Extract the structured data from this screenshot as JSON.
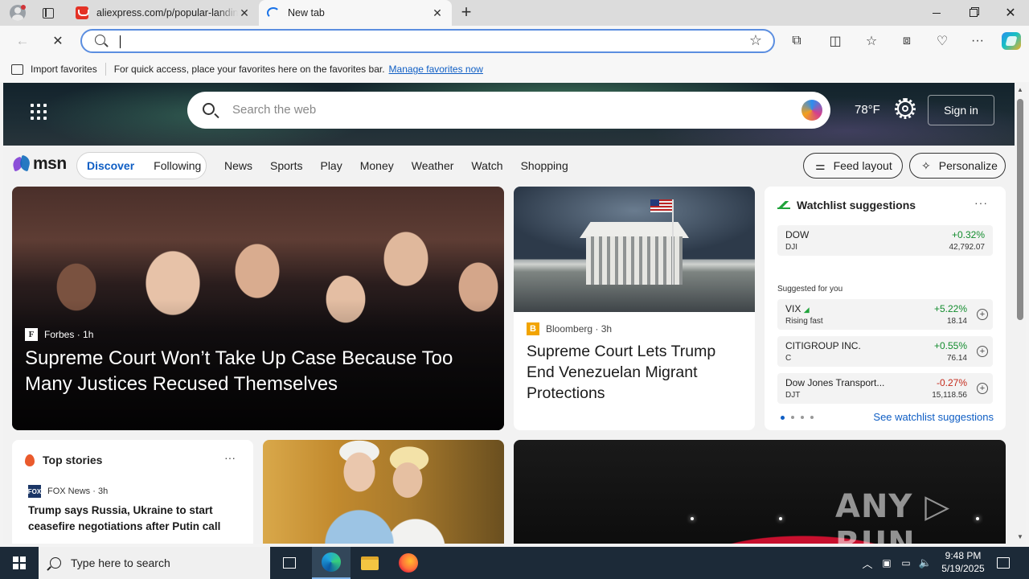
{
  "browser": {
    "tabs": [
      {
        "title": "aliexpress.com/p/popular-landing",
        "close": "✕"
      },
      {
        "title": "New tab",
        "close": "✕"
      }
    ],
    "new_tab": "+",
    "address": {
      "value": ""
    },
    "window": {
      "close": "✕"
    },
    "favorites_bar": {
      "import_label": "Import favorites",
      "message": "For quick access, place your favorites here on the favorites bar.",
      "manage_link": "Manage favorites now"
    }
  },
  "msn": {
    "search_placeholder": "Search the web",
    "weather": "78°F",
    "sign_in": "Sign in",
    "logo": "msn",
    "feed_tabs": {
      "active": "Discover",
      "inactive": "Following"
    },
    "nav": [
      "News",
      "Sports",
      "Play",
      "Money",
      "Weather",
      "Watch",
      "Shopping"
    ],
    "feed_layout": "Feed layout",
    "personalize": "Personalize",
    "hero_card": {
      "source": "Forbes",
      "age": "1h",
      "headline": "Supreme Court Won’t Take Up Case Because Too Many Justices Recused Themselves"
    },
    "mid_card": {
      "source": "Bloomberg",
      "age": "3h",
      "headline": "Supreme Court Lets Trump End Venezuelan Migrant Protections"
    },
    "watchlist": {
      "title": "Watchlist suggestions",
      "more": "···",
      "main": {
        "symbol": "DOW",
        "sub": "DJI",
        "change": "+0.32%",
        "price": "42,792.07"
      },
      "suggested_label": "Suggested for you",
      "suggested": [
        {
          "symbol": "VIX",
          "sub": "Rising fast",
          "change": "+5.22%",
          "price": "18.14",
          "trend": "up"
        },
        {
          "symbol": "CITIGROUP INC.",
          "sub": "C",
          "change": "+0.55%",
          "price": "76.14",
          "trend": "up"
        },
        {
          "symbol": "Dow Jones Transport...",
          "sub": "DJT",
          "change": "-0.27%",
          "price": "15,118.56",
          "trend": "down"
        }
      ],
      "see_link": "See watchlist suggestions"
    },
    "top_stories": {
      "title": "Top stories",
      "more": "···",
      "source": "FOX News",
      "age": "3h",
      "headline": "Trump says Russia, Ukraine to start ceasefire negotiations after Putin call"
    },
    "watermark": "ANY ▷ RUN"
  },
  "taskbar": {
    "search_placeholder": "Type here to search",
    "time": "9:48 PM",
    "date": "5/19/2025"
  },
  "colors": {
    "accent": "#0f5ec4",
    "up": "#138c2e",
    "down": "#c42b1c",
    "taskbar": "#1c2a38"
  }
}
